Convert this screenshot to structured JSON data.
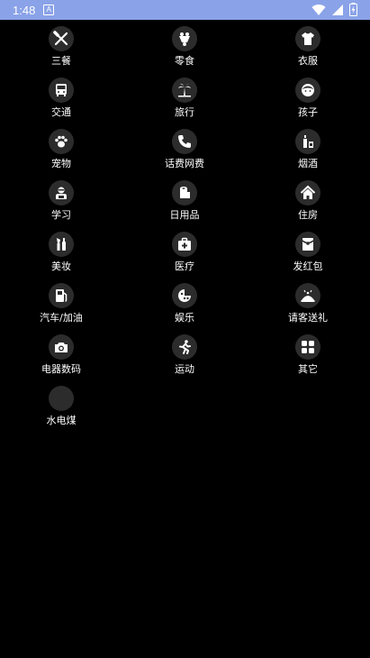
{
  "status_bar": {
    "time": "1:48",
    "notification_glyph": "A"
  },
  "categories": [
    {
      "label": "三餐",
      "icon": "utensils-icon"
    },
    {
      "label": "零食",
      "icon": "snack-icon"
    },
    {
      "label": "衣服",
      "icon": "shirt-icon"
    },
    {
      "label": "交通",
      "icon": "bus-icon"
    },
    {
      "label": "旅行",
      "icon": "palm-tree-icon"
    },
    {
      "label": "孩子",
      "icon": "child-icon"
    },
    {
      "label": "宠物",
      "icon": "paw-icon"
    },
    {
      "label": "话费网费",
      "icon": "phone-icon"
    },
    {
      "label": "烟酒",
      "icon": "bottle-icon"
    },
    {
      "label": "学习",
      "icon": "student-icon"
    },
    {
      "label": "日用品",
      "icon": "toilet-paper-icon"
    },
    {
      "label": "住房",
      "icon": "house-icon"
    },
    {
      "label": "美妆",
      "icon": "cosmetics-icon"
    },
    {
      "label": "医疗",
      "icon": "medical-kit-icon"
    },
    {
      "label": "发红包",
      "icon": "red-envelope-icon"
    },
    {
      "label": "汽车/加油",
      "icon": "fuel-pump-icon"
    },
    {
      "label": "娱乐",
      "icon": "game-icon"
    },
    {
      "label": "请客送礼",
      "icon": "gift-icon"
    },
    {
      "label": "电器数码",
      "icon": "camera-icon"
    },
    {
      "label": "运动",
      "icon": "running-icon"
    },
    {
      "label": "其它",
      "icon": "grid-icon"
    },
    {
      "label": "水电煤",
      "icon": "blank-icon"
    }
  ]
}
